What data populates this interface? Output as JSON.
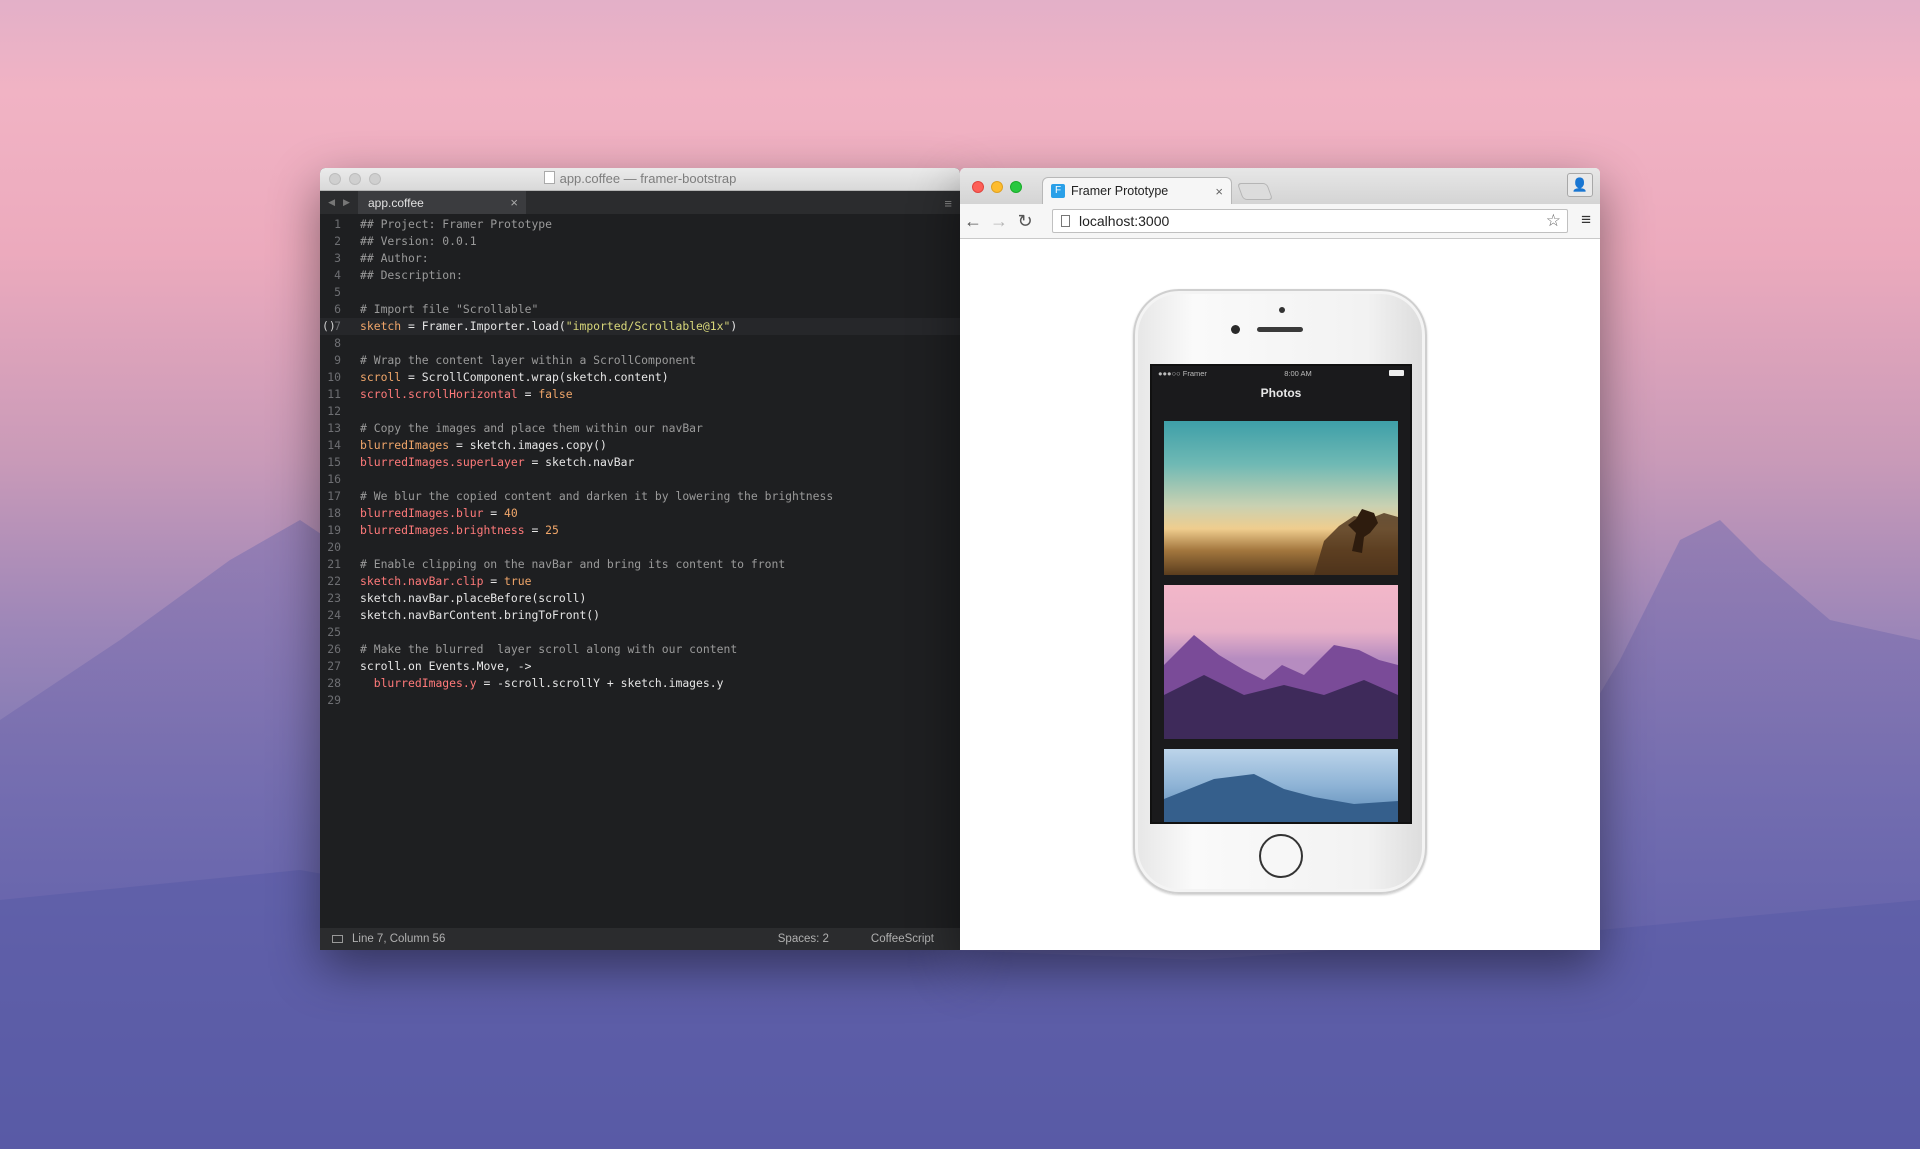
{
  "editor": {
    "window_title": "app.coffee — framer-bootstrap",
    "tab_label": "app.coffee",
    "tab_close": "×",
    "menu_glyph": "≡",
    "status": {
      "position": "Line 7, Column 56",
      "spaces": "Spaces: 2",
      "syntax": "CoffeeScript"
    },
    "active_line": 7,
    "lines": [
      "## Project: Framer Prototype",
      "## Version: 0.0.1",
      "## Author:",
      "## Description:",
      "",
      "# Import file \"Scrollable\"",
      "sketch = Framer.Importer.load(\"imported/Scrollable@1x\")",
      "",
      "# Wrap the content layer within a ScrollComponent",
      "scroll = ScrollComponent.wrap(sketch.content)",
      "scroll.scrollHorizontal = false",
      "",
      "# Copy the images and place them within our navBar",
      "blurredImages = sketch.images.copy()",
      "blurredImages.superLayer = sketch.navBar",
      "",
      "# We blur the copied content and darken it by lowering the brightness",
      "blurredImages.blur = 40",
      "blurredImages.brightness = 25",
      "",
      "# Enable clipping on the navBar and bring its content to front",
      "sketch.navBar.clip = true",
      "sketch.navBar.placeBefore(scroll)",
      "sketch.navBarContent.bringToFront()",
      "",
      "# Make the blurred  layer scroll along with our content",
      "scroll.on Events.Move, ->",
      "  blurredImages.y = -scroll.scrollY + sketch.images.y",
      ""
    ]
  },
  "browser": {
    "tab_title": "Framer Prototype",
    "tab_close": "×",
    "favicon_letter": "F",
    "url": "localhost:3000",
    "back": "←",
    "forward": "→",
    "reload": "↻",
    "star": "☆",
    "menu": "≡",
    "profile": "👤"
  },
  "phone": {
    "carrier": "●●●○○ Framer",
    "time": "8:00 AM",
    "nav_title": "Photos"
  },
  "colors": {
    "editor_bg": "#1e1f21",
    "comment": "#9a9a9a",
    "variable": "#f0a66a",
    "property_red": "#ff7a7a",
    "string": "#d8d77a",
    "traffic_red": "#fd5f57",
    "traffic_yellow": "#febc2e",
    "traffic_green": "#28c840"
  }
}
